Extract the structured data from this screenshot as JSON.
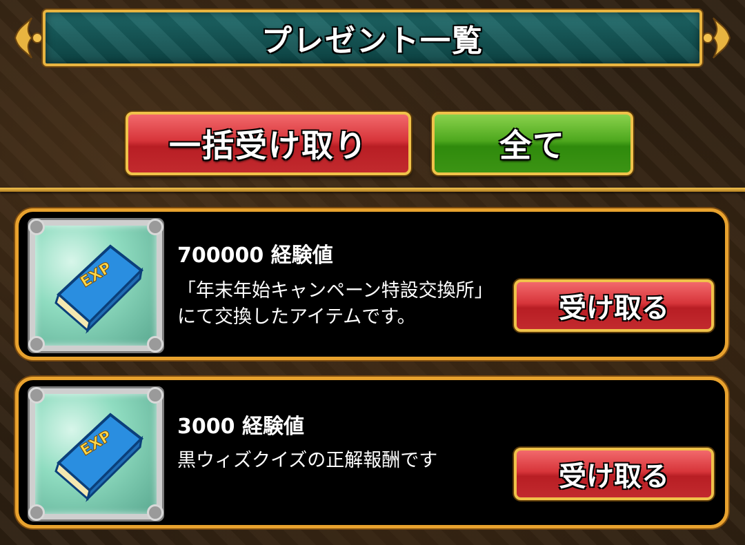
{
  "title": "プレゼント一覧",
  "buttons": {
    "claim_all": "一括受け取り",
    "show_all": "全て"
  },
  "colors": {
    "banner": "#0d4747",
    "border_gold": "#e8a22e",
    "button_red": "#d7353a",
    "button_green": "#4ea81e"
  },
  "presents": [
    {
      "icon": "exp-book-icon",
      "name": "700000 経験値",
      "description": "「年末年始キャンペーン特設交換所」にて交換したアイテムです。",
      "action": "受け取る"
    },
    {
      "icon": "exp-book-icon",
      "name": "3000 経験値",
      "description": "黒ウィズクイズの正解報酬です",
      "action": "受け取る"
    }
  ]
}
